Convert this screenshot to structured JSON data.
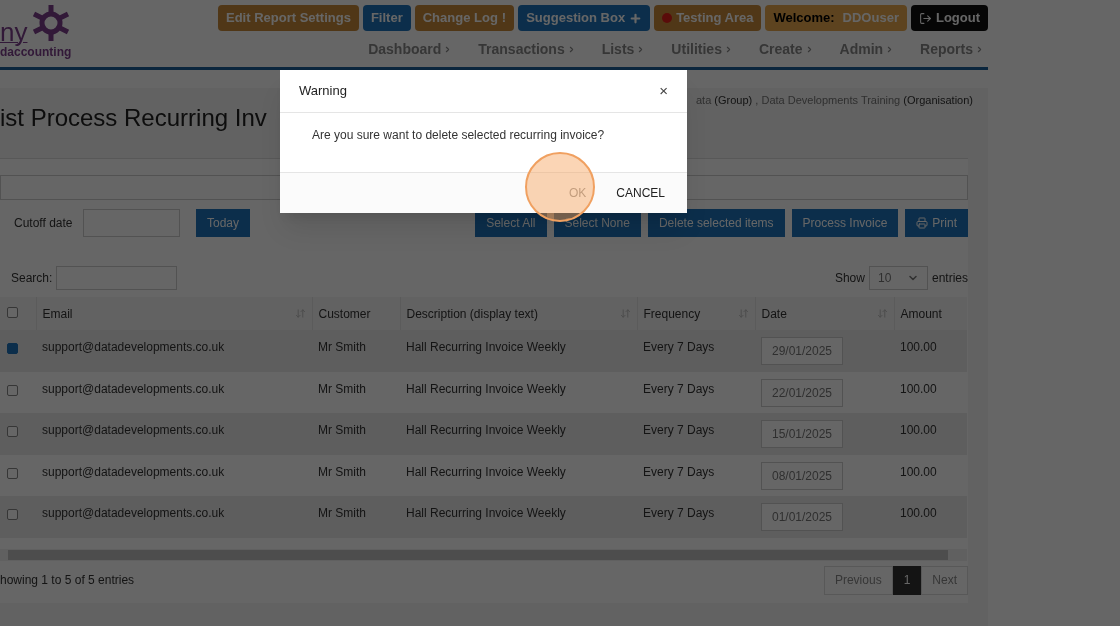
{
  "logo": {
    "text_top": "ny",
    "text_bottom": "daccounting"
  },
  "top_buttons": [
    {
      "label": "Edit Report Settings",
      "kind": "settings"
    },
    {
      "label": "Filter",
      "kind": "filter"
    },
    {
      "label": "Change Log",
      "suffix": "!",
      "kind": "log"
    },
    {
      "label": "Suggestion Box",
      "kind": "suggestion"
    },
    {
      "label": "Testing Area",
      "kind": "testing"
    },
    {
      "label": "Welcome:",
      "suffix": "DDOuser",
      "kind": "welcome"
    },
    {
      "label": "Logout",
      "kind": "logout"
    }
  ],
  "nav": [
    {
      "label": "Dashboard"
    },
    {
      "label": "Transactions"
    },
    {
      "label": "Lists"
    },
    {
      "label": "Utilities"
    },
    {
      "label": "Create"
    },
    {
      "label": "Admin"
    },
    {
      "label": "Reports"
    }
  ],
  "breadcrumb": [
    {
      "name": "ata",
      "type": "(Group)"
    },
    {
      "name": "Data Developments Training",
      "type": "(Organisation)"
    }
  ],
  "breadcrumb_separator": ",",
  "page_title": "ist Process Recurring Inv",
  "cutoff": {
    "label": "Cutoff date",
    "button": "Today"
  },
  "actions": [
    {
      "label": "Select All"
    },
    {
      "label": "Select None"
    },
    {
      "label": "Delete selected items"
    },
    {
      "label": "Process Invoice"
    },
    {
      "label": "Print",
      "kind": "print"
    }
  ],
  "search": {
    "label": "Search:"
  },
  "page_size": {
    "label": "Show",
    "value": "10",
    "suffix": "entries"
  },
  "table": {
    "header_checked": false,
    "columns": [
      {
        "label": "Email",
        "sortable": true
      },
      {
        "label": "Customer",
        "sortable": false
      },
      {
        "label": "Description (display text)",
        "sortable": true
      },
      {
        "label": "Frequency",
        "sortable": true
      },
      {
        "label": "Date",
        "sortable": true
      },
      {
        "label": "Amount",
        "sortable": false
      }
    ],
    "rows": [
      {
        "checked": true,
        "email": "support@datadevelopments.co.uk",
        "customer": "Mr Smith",
        "description": "Hall Recurring Invoice Weekly",
        "frequency": "Every 7 Days",
        "date": "29/01/2025",
        "amount": "100.00"
      },
      {
        "checked": false,
        "email": "support@datadevelopments.co.uk",
        "customer": "Mr Smith",
        "description": "Hall Recurring Invoice Weekly",
        "frequency": "Every 7 Days",
        "date": "22/01/2025",
        "amount": "100.00"
      },
      {
        "checked": false,
        "email": "support@datadevelopments.co.uk",
        "customer": "Mr Smith",
        "description": "Hall Recurring Invoice Weekly",
        "frequency": "Every 7 Days",
        "date": "15/01/2025",
        "amount": "100.00"
      },
      {
        "checked": false,
        "email": "support@datadevelopments.co.uk",
        "customer": "Mr Smith",
        "description": "Hall Recurring Invoice Weekly",
        "frequency": "Every 7 Days",
        "date": "08/01/2025",
        "amount": "100.00"
      },
      {
        "checked": false,
        "email": "support@datadevelopments.co.uk",
        "customer": "Mr Smith",
        "description": "Hall Recurring Invoice Weekly",
        "frequency": "Every 7 Days",
        "date": "01/01/2025",
        "amount": "100.00"
      }
    ]
  },
  "info": "howing 1 to 5 of 5 entries",
  "pagination": [
    {
      "label": "Previous",
      "selected": false
    },
    {
      "label": "1",
      "selected": true
    },
    {
      "label": "Next",
      "selected": false
    }
  ],
  "modal": {
    "title": "Warning",
    "close": "×",
    "message": "Are you sure want to delete selected recurring invoice?",
    "ok": "OK",
    "cancel": "CANCEL",
    "ok_disabled": true
  }
}
